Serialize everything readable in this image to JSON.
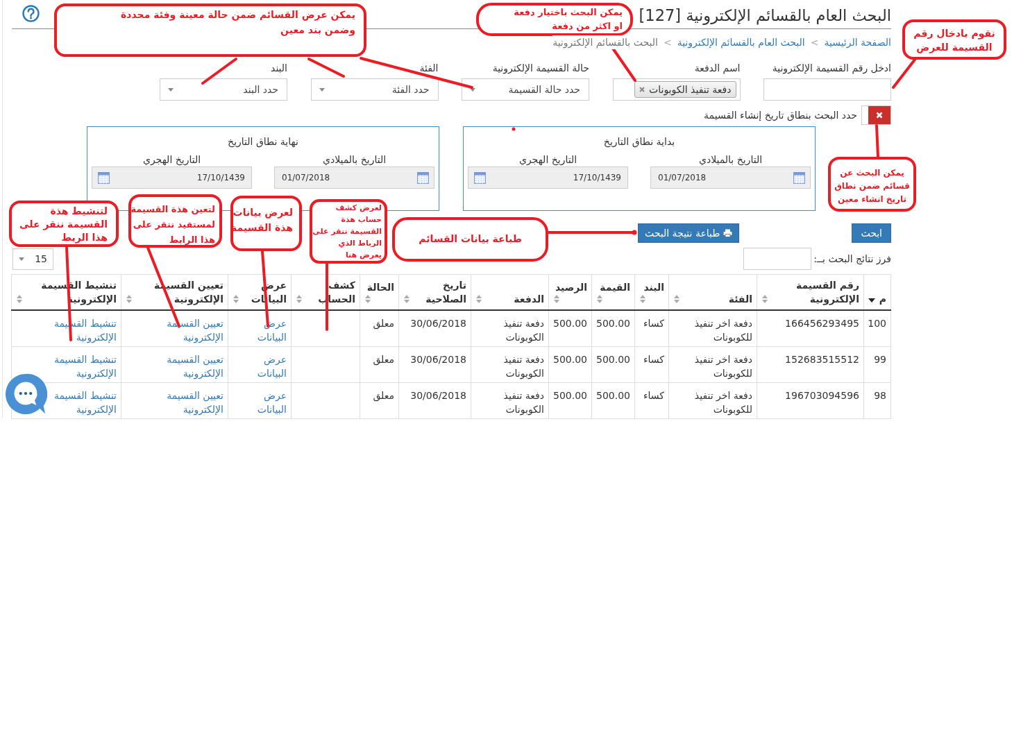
{
  "header": {
    "title": "البحث العام بالقسائم الإلكترونية [127]"
  },
  "breadcrumb": [
    {
      "label": "الصفحة الرئيسية",
      "kind": "link"
    },
    {
      "label": "البحث العام بالقسائم الإلكترونية",
      "kind": "link",
      "separator": "<"
    },
    {
      "label": "البحث بالقسائم الإلكترونية",
      "kind": "current",
      "separator": "<"
    }
  ],
  "filters": [
    {
      "label": "ادخل رقم القسيمة الإلكترونية",
      "kind": "text"
    },
    {
      "label": "اسم الدفعة",
      "kind": "tags",
      "tags": [
        "دفعة تنفيذ الكوبونات"
      ]
    },
    {
      "label": "حالة القسيمة الإلكترونية",
      "kind": "select",
      "placeholder": "حدد حالة القسيمة"
    },
    {
      "label": "الفئة",
      "kind": "select",
      "placeholder": "حدد الفئة"
    },
    {
      "label": "البند",
      "kind": "select",
      "placeholder": "حدد البند"
    }
  ],
  "date_range_toggle": {
    "label": "حدد البحث بنطاق تاريخ إنشاء القسيمة",
    "on": false
  },
  "date_ranges": [
    {
      "title": "بداية نطاق التاريخ",
      "fields": [
        {
          "label": "التاريخ بالميلادي",
          "kind": "gregorian",
          "value": "01/07/2018"
        },
        {
          "label": "التاريخ الهجري",
          "kind": "hijri",
          "value": "17/10/1439"
        }
      ]
    },
    {
      "title": "نهاية نطاق التاريخ",
      "fields": [
        {
          "label": "التاريخ بالميلادي",
          "kind": "gregorian",
          "value": "01/07/2018"
        },
        {
          "label": "التاريخ الهجري",
          "kind": "hijri",
          "value": "17/10/1439"
        }
      ]
    }
  ],
  "actions": [
    {
      "label": "ابحث",
      "kind": "search"
    },
    {
      "label": "طباعة نتيجة البحث",
      "kind": "print"
    }
  ],
  "sort_by": {
    "label": "فرز نتائج البحث بــ:"
  },
  "page_size": {
    "value": "15"
  },
  "table": {
    "columns": [
      {
        "label": "م",
        "sorted": true,
        "kind": "text"
      },
      {
        "label": "رقم القسيمة الإلكترونية",
        "sorted": false,
        "kind": "text"
      },
      {
        "label": "الفئة",
        "sorted": false,
        "kind": "text"
      },
      {
        "label": "البند",
        "sorted": false,
        "kind": "text"
      },
      {
        "label": "القيمة",
        "sorted": false,
        "kind": "text"
      },
      {
        "label": "الرصيد",
        "sorted": false,
        "kind": "text"
      },
      {
        "label": "الدفعة",
        "sorted": false,
        "kind": "text"
      },
      {
        "label": "تاريخ الصلاحية",
        "sorted": false,
        "kind": "text"
      },
      {
        "label": "الحالة",
        "sorted": false,
        "kind": "text"
      },
      {
        "label": "كشف الحساب",
        "sorted": false,
        "kind": "link"
      },
      {
        "label": "عرض البيانات",
        "sorted": false,
        "kind": "link"
      },
      {
        "label": "تعيين القسيمة الإلكترونية",
        "sorted": false,
        "kind": "link"
      },
      {
        "label": "تنشيط القسيمة الإلكترونية",
        "sorted": false,
        "kind": "link"
      }
    ],
    "rows": [
      {
        "cells": [
          "100",
          "166456293495",
          "دفعة اخر تنفيذ للكوبونات",
          "كساء",
          "500.00",
          "500.00",
          "دفعة تنفيذ الكوبونات",
          "30/06/2018",
          "معلق",
          null,
          "عرض\nالبيانات",
          "تعيين القسيمة\nالإلكترونية",
          "تنشيط القسيمة\nالإلكترونية"
        ]
      },
      {
        "cells": [
          "99",
          "152683515512",
          "دفعة اخر تنفيذ للكوبونات",
          "كساء",
          "500.00",
          "500.00",
          "دفعة تنفيذ الكوبونات",
          "30/06/2018",
          "معلق",
          null,
          "عرض\nالبيانات",
          "تعيين القسيمة\nالإلكترونية",
          "تنشيط القسيمة\nالإلكترونية"
        ]
      },
      {
        "cells": [
          "98",
          "196703094596",
          "دفعة اخر تنفيذ للكوبونات",
          "كساء",
          "500.00",
          "500.00",
          "دفعة تنفيذ الكوبونات",
          "30/06/2018",
          "معلق",
          null,
          "عرض\nالبيانات",
          "تعيين القسيمة\nالإلكترونية",
          "تنشيط القسيمة\nالإلكترونية"
        ]
      }
    ]
  },
  "annotations": [
    {
      "text": "نقوم بادخال رقم\nالقسيمة للعرض"
    },
    {
      "text": "يمكن البحث باختيار دفعة\nاو اكثر من دفعة"
    },
    {
      "text": "يمكن عرض القسائم ضمن حالة معينة وفئة محددة\nوضمن بند معين"
    },
    {
      "text": "يمكن البحث عن\nقسائم ضمن نطاق\nتاريخ انشاء معين"
    },
    {
      "text": "طباعة بيانات القسائم"
    },
    {
      "text": "لعرض كشف\nحساب هذة\nالقسيمة ننقر على\nالرباط الذي\nيعرض هنا"
    },
    {
      "text": "لعرض بيانات\nهذة القسيمة"
    },
    {
      "text": "لتعين هذة القسيمة\nلمستفيد ننقر على\nهذا الرابط"
    },
    {
      "text": "لتنشيط هذة\nالقسيمة ننقر على\nهذا الربط"
    }
  ]
}
